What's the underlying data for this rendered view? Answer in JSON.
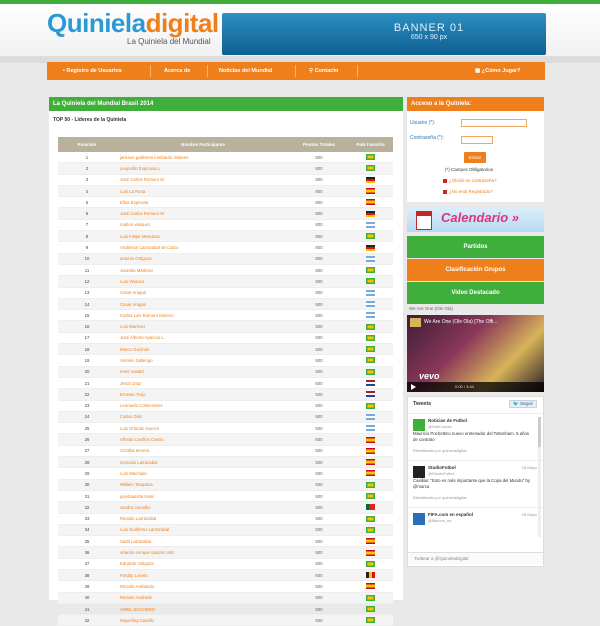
{
  "header": {
    "logo_left": "Quiniela",
    "logo_right": "digital",
    "logo_sub": "La Quiniela del Mundial",
    "banner_title": "BANNER 01",
    "banner_size": "650 x 90 px"
  },
  "nav": {
    "items": [
      "Registro de Usuarios",
      "Acerca de",
      "Noticias del Mundial",
      "Contacto"
    ],
    "right": "¿Cómo Jugar?"
  },
  "main": {
    "title": "La Quiniela del Mundial Brasil 2014",
    "subtitle": "TOP 50 - Líderes de la Quiniela",
    "columns": [
      "Posición",
      "Nombre Participante",
      "Puntos Totales",
      "País Favorito"
    ],
    "rows": [
      [
        "1",
        "jackson guillermo lombardo milanez",
        "800",
        "brazil"
      ],
      [
        "2",
        "Leopoldo Espinosa L.",
        "800",
        "brazil"
      ],
      [
        "3",
        "José Carlos Romero M",
        "800",
        "germany"
      ],
      [
        "4",
        "Luis La Rosa",
        "800",
        "spain"
      ],
      [
        "5",
        "Elías Espinosa",
        "800",
        "spain"
      ],
      [
        "6",
        "José Carlos Romero M",
        "800",
        "germany"
      ],
      [
        "7",
        "marlon vásquez",
        "800",
        "argentina"
      ],
      [
        "8",
        "Luis Felipe Mendoza",
        "800",
        "brazil"
      ],
      [
        "9",
        "Anderson Larrazabal de Calzo",
        "800",
        "germany"
      ],
      [
        "10",
        "antonio Ortigoza",
        "800",
        "argentina"
      ],
      [
        "11",
        "Joseslia Martinez",
        "800",
        "brazil"
      ],
      [
        "12",
        "Luis Velasco",
        "800",
        "brazil"
      ],
      [
        "13",
        "Cesar Araguri",
        "800",
        "argentina"
      ],
      [
        "14",
        "Cesar Araguri",
        "500",
        "argentina"
      ],
      [
        "15",
        "Carlos Luis Romero Moreno",
        "500",
        "argentina"
      ],
      [
        "16",
        "Luis Martinez",
        "500",
        "brazil"
      ],
      [
        "17",
        "José Alberto Aparicio L.",
        "500",
        "brazil"
      ],
      [
        "18",
        "Marco Guzmán",
        "500",
        "brazil"
      ],
      [
        "19",
        "Antonio Sallengo",
        "500",
        "brazil"
      ],
      [
        "20",
        "Irene navatti",
        "500",
        "brazil"
      ],
      [
        "21",
        "Jesús Díaz",
        "500",
        "netherlands"
      ],
      [
        "22",
        "Ernesto Trejo",
        "500",
        "netherlands"
      ],
      [
        "23",
        "Leonardo Colmenares",
        "500",
        "brazil"
      ],
      [
        "24",
        "Carlos Díaz",
        "500",
        "argentina"
      ],
      [
        "25",
        "Luis Orlando Guerra",
        "500",
        "argentina"
      ],
      [
        "26",
        "Alfredo Casillos Castro",
        "500",
        "spain"
      ],
      [
        "27",
        "Cristhia Morera",
        "500",
        "spain"
      ],
      [
        "28",
        "Gonzalo Larrazabal",
        "500",
        "spain"
      ],
      [
        "29",
        "Luis Machado",
        "500",
        "spain"
      ],
      [
        "30",
        "William Tarapaza",
        "500",
        "brazil"
      ],
      [
        "31",
        "juanbautista tovar",
        "500",
        "brazil"
      ],
      [
        "32",
        "sandra carvalho",
        "500",
        "portugal"
      ],
      [
        "33",
        "Ricardo Larrazabal",
        "500",
        "brazil"
      ],
      [
        "34",
        "Luis Guillermo Larrazabal",
        "500",
        "brazil"
      ],
      [
        "35",
        "Sadit Larrazabal",
        "500",
        "spain"
      ],
      [
        "36",
        "orlando enrique salazar ortiz",
        "500",
        "spain"
      ],
      [
        "37",
        "Eduardo Ortigoza",
        "500",
        "brazil"
      ],
      [
        "38",
        "Freddy Loneto",
        "500",
        "belgium"
      ],
      [
        "39",
        "Ricardo Ambando",
        "500",
        "spain"
      ],
      [
        "40",
        "Ricardo Andrade",
        "500",
        "brazil"
      ],
      [
        "41",
        "ARIEL SUCHERO",
        "500",
        "brazil"
      ],
      [
        "42",
        "Mayerling Castillo",
        "500",
        "brazil"
      ]
    ]
  },
  "sidebar": {
    "access_title": "Acceso a la Quiniela:",
    "user_label": "Usuario (*):",
    "pass_label": "Contraseña (*):",
    "submit": "Entrar",
    "required": "(*) Campos Obligatorios",
    "forgot": "¿Olvidó su contraseña?",
    "not_registered": "¿No está Registrado?",
    "calendar": "Calendario »",
    "buttons": [
      "Partidos",
      "Clasificación Grupos",
      "Video Destacado"
    ],
    "video_label": "We Are One (Ole Ola)",
    "video_title": "We Are One (Ole Ola) [The Offi...",
    "video_brand": "vevo",
    "video_time": "0:00 / 3:44"
  },
  "tweets": {
    "title": "Tweets",
    "follow": "Seguir",
    "items": [
      {
        "name": "Noticias de Futbol",
        "handle": "@NotiCracks",
        "date": "",
        "text": "Mauricio Pochettino nuevo entrenador del Tottenham. 5 años de contrato",
        "rt": "Retwitteado por quinieladigital"
      },
      {
        "name": "StudioFutbol",
        "handle": "@StudioFutbol",
        "date": "28 Mayo",
        "text": "Casillas: \"Esto es más importante que la Copa del Mundo\" by @marca",
        "rt": "Retwitteado por quinieladigital"
      },
      {
        "name": "FIFA.com en español",
        "handle": "@fifacom_es",
        "date": "28 Mayo",
        "text": "",
        "rt": ""
      }
    ],
    "compose": "Twittear a @QuinielaDigital"
  },
  "colors": {
    "green": "#3fae3a",
    "orange": "#ef7f1a",
    "blue": "#2a9ad6"
  }
}
